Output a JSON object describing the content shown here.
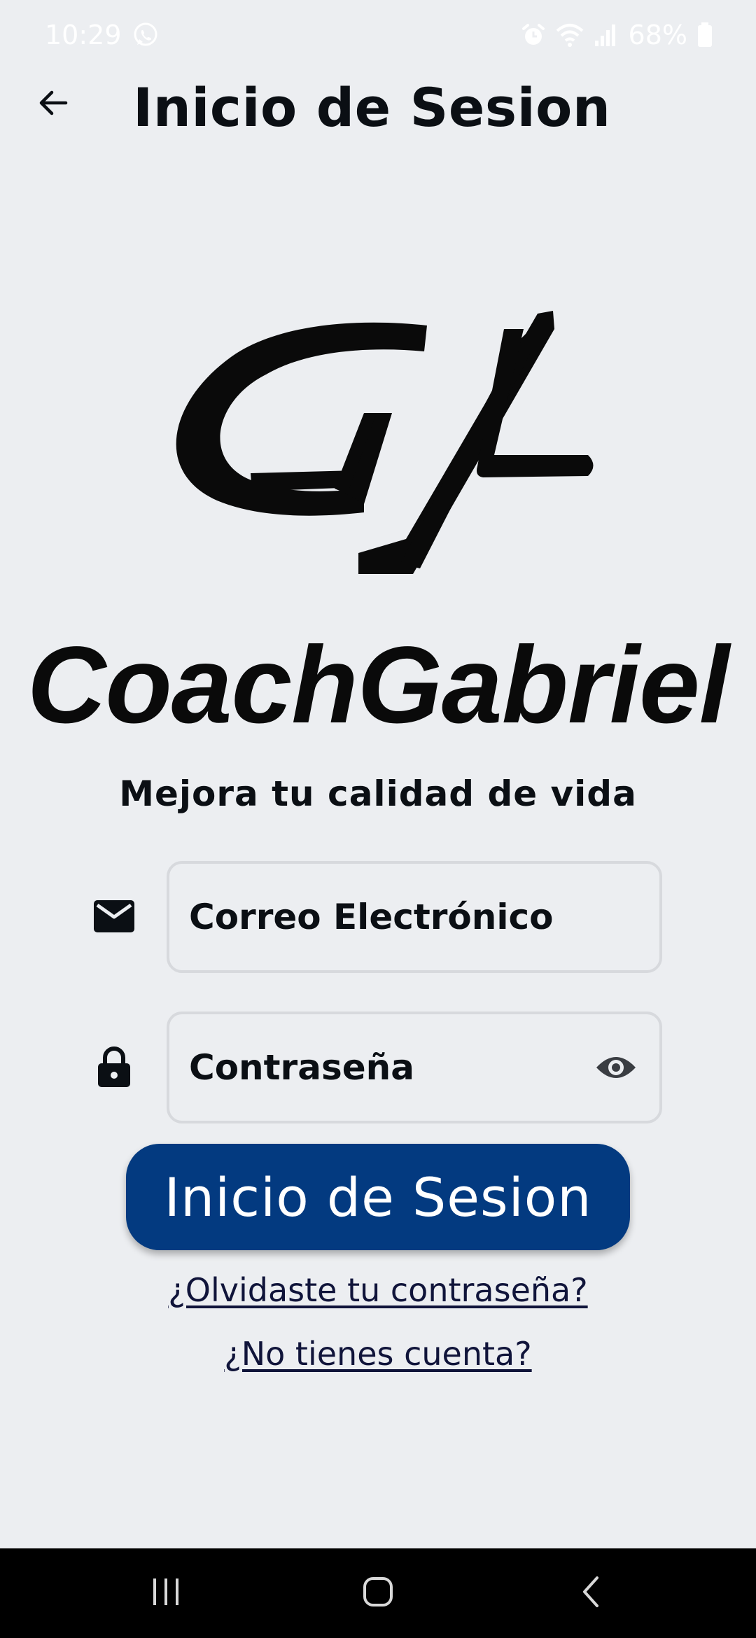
{
  "status_bar": {
    "time": "10:29",
    "battery": "68%",
    "icons": [
      "whatsapp-icon",
      "alarm-icon",
      "wifi-icon",
      "signal-icon",
      "battery-icon"
    ]
  },
  "app_bar": {
    "title": "Inicio de Sesion",
    "back_icon": "arrow-back-icon"
  },
  "branding": {
    "logo_icon": "cg-logo-mark",
    "name": "CoachGabriel",
    "tagline": "Mejora tu calidad de vida"
  },
  "form": {
    "email": {
      "icon": "mail-icon",
      "placeholder": "Correo Electrónico"
    },
    "password": {
      "icon": "lock-icon",
      "placeholder": "Contraseña",
      "toggle_icon": "eye-icon"
    },
    "submit_label": "Inicio de Sesion",
    "forgot_link": "¿Olvidaste tu contraseña?",
    "register_link": "¿No tienes cuenta?"
  },
  "nav_bar": {
    "icons": [
      "recent-apps-icon",
      "home-icon",
      "back-icon"
    ]
  },
  "colors": {
    "background": "#eceef1",
    "primary_button": "#033a80",
    "text": "#0b0f14",
    "link": "#10143a"
  }
}
